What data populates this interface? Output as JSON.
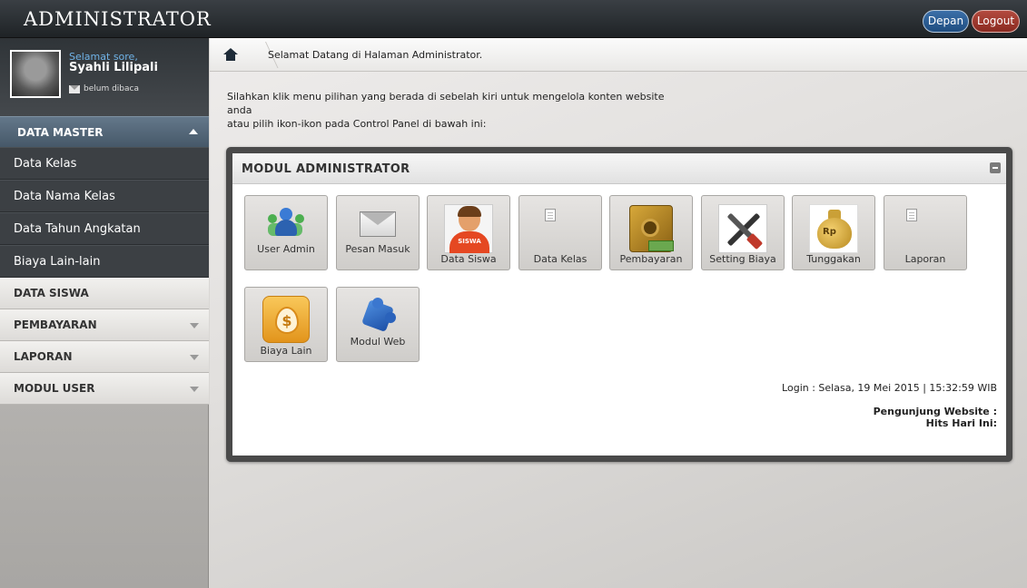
{
  "header": {
    "brand": "ADMINISTRATOR",
    "depan_label": "Depan",
    "logout_label": "Logout"
  },
  "profile": {
    "greeting": "Selamat sore,",
    "name": "Syahli Lilipali",
    "message_status": "belum dibaca"
  },
  "sidebar": {
    "data_master": {
      "label": "DATA MASTER",
      "items": [
        {
          "label": "Data Kelas"
        },
        {
          "label": "Data Nama Kelas"
        },
        {
          "label": "Data Tahun Angkatan"
        },
        {
          "label": "Biaya Lain-lain"
        }
      ]
    },
    "categories": [
      {
        "label": "DATA SISWA"
      },
      {
        "label": "PEMBAYARAN"
      },
      {
        "label": "LAPORAN"
      },
      {
        "label": "MODUL USER"
      }
    ]
  },
  "breadcrumb": {
    "text": "Selamat Datang di Halaman Administrator."
  },
  "intro": {
    "line1": "Silahkan klik menu pilihan yang berada di sebelah kiri untuk mengelola konten website anda",
    "line2": "atau pilih ikon-ikon pada Control Panel di bawah ini:"
  },
  "panel": {
    "title": "MODUL ADMINISTRATOR",
    "tiles": [
      {
        "label": "User Admin",
        "icon": "users-icon"
      },
      {
        "label": "Pesan Masuk",
        "icon": "envelope-icon"
      },
      {
        "label": "Data Siswa",
        "icon": "student-icon"
      },
      {
        "label": "Data Kelas",
        "icon": "broken-image-icon"
      },
      {
        "label": "Pembayaran",
        "icon": "safe-icon"
      },
      {
        "label": "Setting Biaya",
        "icon": "tools-icon"
      },
      {
        "label": "Tunggakan",
        "icon": "money-bag-icon"
      },
      {
        "label": "Laporan",
        "icon": "broken-image-icon"
      },
      {
        "label": "Biaya Lain",
        "icon": "dollar-drop-icon"
      },
      {
        "label": "Modul Web",
        "icon": "puzzle-icon"
      }
    ],
    "siswa_badge": "SISWA",
    "rp_badge": "Rp",
    "dollar_badge": "$",
    "login_info": "Login : Selasa, 19 Mei 2015 | 15:32:59 WIB",
    "visitors_label": "Pengunjung Website :",
    "hits_label": "Hits Hari Ini:"
  },
  "colors": {
    "depan_button": "#2a5b93",
    "logout_button": "#9c3328",
    "greeting_text": "#6fb2e6"
  }
}
